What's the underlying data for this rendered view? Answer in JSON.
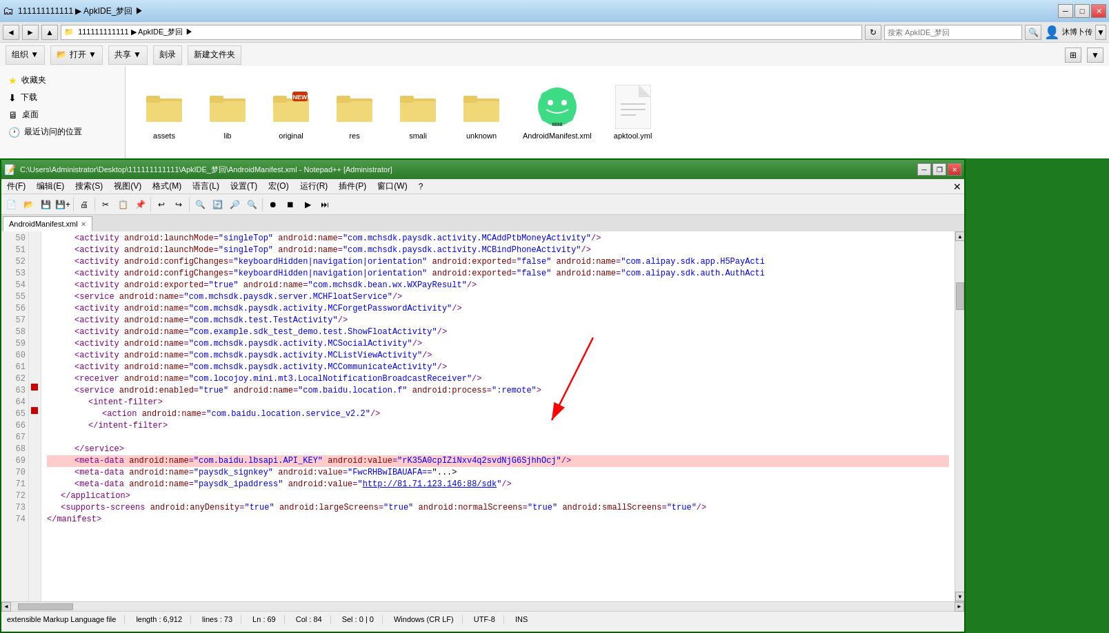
{
  "explorer": {
    "title": "111111111111",
    "path": "111111111111 ▶ ApkIDE_梦回 ▶",
    "search_placeholder": "搜索 ApkIDE_梦回",
    "nav_buttons": [
      "◄",
      "►",
      "▲"
    ],
    "toolbar_buttons": [
      "组织 ▼",
      "打开 ▼",
      "共享 ▼",
      "刻录",
      "新建文件夹"
    ],
    "sidebar_items": [
      {
        "label": "收藏夹",
        "icon": "star"
      },
      {
        "label": "下载",
        "icon": "folder"
      },
      {
        "label": "桌面",
        "icon": "desktop"
      },
      {
        "label": "最近访问的位置",
        "icon": "recent"
      }
    ],
    "files": [
      {
        "name": "assets",
        "type": "folder"
      },
      {
        "name": "lib",
        "type": "folder"
      },
      {
        "name": "original",
        "type": "folder-new"
      },
      {
        "name": "res",
        "type": "folder"
      },
      {
        "name": "smali",
        "type": "folder"
      },
      {
        "name": "unknown",
        "type": "folder"
      },
      {
        "name": "AndroidManifest.xml",
        "type": "android"
      },
      {
        "name": "apktool.yml",
        "type": "text"
      }
    ]
  },
  "notepad": {
    "title": "C:\\Users\\Administrator\\Desktop\\111111111111\\ApkIDE_梦回\\AndroidManifest.xml - Notepad++ [Administrator]",
    "tab_label": "AndroidManifest.xml",
    "menu_items": [
      "件(F)",
      "编辑(E)",
      "搜索(S)",
      "视图(V)",
      "格式(M)",
      "语言(L)",
      "设置(T)",
      "宏(O)",
      "运行(R)",
      "插件(P)",
      "窗口(W)",
      "?"
    ],
    "status": {
      "file_type": "extensible Markup Language file",
      "length": "length : 6,912",
      "lines": "lines : 73",
      "ln": "Ln : 69",
      "col": "Col : 84",
      "sel": "Sel : 0 | 0",
      "line_endings": "Windows (CR LF)",
      "encoding": "UTF-8",
      "mode": "INS"
    },
    "code_lines": [
      {
        "num": 50,
        "indent": 2,
        "content": "<activity android:launchMode=\"singleTop\" android:name=\"com.mchsdk.paysdk.activity.MCAddPtbMoneyActivity\"/>"
      },
      {
        "num": 51,
        "indent": 2,
        "content": "<activity android:launchMode=\"singleTop\" android:name=\"com.mchsdk.paysdk.activity.MCBindPhoneActivity\"/>"
      },
      {
        "num": 52,
        "indent": 2,
        "content": "<activity android:configChanges=\"keyboardHidden|navigation|orientation\" android:exported=\"false\" android:name=\"com.alipay.sdk.app.H5PayActi"
      },
      {
        "num": 53,
        "indent": 2,
        "content": "<activity android:configChanges=\"keyboardHidden|navigation|orientation\" android:exported=\"false\" android:name=\"com.alipay.sdk.auth.AuthActi"
      },
      {
        "num": 54,
        "indent": 2,
        "content": "<activity android:exported=\"true\" android:name=\"com.mchsdk.bean.wx.WXPayResult\"/>"
      },
      {
        "num": 55,
        "indent": 2,
        "content": "<service android:name=\"com.mchsdk.paysdk.server.MCHFloatService\"/>"
      },
      {
        "num": 56,
        "indent": 2,
        "content": "<activity android:name=\"com.mchsdk.paysdk.activity.MCForgetPasswordActivity\"/>"
      },
      {
        "num": 57,
        "indent": 2,
        "content": "<activity android:name=\"com.mchsdk.test.TestActivity\"/>"
      },
      {
        "num": 58,
        "indent": 2,
        "content": "<activity android:name=\"com.example.sdk_test_demo.test.ShowFloatActivity\"/>"
      },
      {
        "num": 59,
        "indent": 2,
        "content": "<activity android:name=\"com.mchsdk.paysdk.activity.MCSocialActivity\"/>"
      },
      {
        "num": 60,
        "indent": 2,
        "content": "<activity android:name=\"com.mchsdk.paysdk.activity.MCListViewActivity\"/>"
      },
      {
        "num": 61,
        "indent": 2,
        "content": "<activity android:name=\"com.mchsdk.paysdk.activity.MCCommunicateActivity\"/>"
      },
      {
        "num": 62,
        "indent": 2,
        "content": "<receiver android:name=\"com.locojoy.mini.mt3.LocalNotificationBroadcastReceiver\"/>"
      },
      {
        "num": 63,
        "indent": 2,
        "content": "<service android:enabled=\"true\" android:name=\"com.baidu.location.f\" android:process=\":remote\">"
      },
      {
        "num": 64,
        "indent": 3,
        "content": "<intent-filter>",
        "mark": true
      },
      {
        "num": 65,
        "indent": 4,
        "content": "<action android:name=\"com.baidu.location.service_v2.2\"/>"
      },
      {
        "num": 66,
        "indent": 3,
        "content": "</intent-filter>",
        "mark": true
      },
      {
        "num": 67,
        "indent": 0,
        "content": ""
      },
      {
        "num": 68,
        "indent": 2,
        "content": "</service>"
      },
      {
        "num": 69,
        "indent": 2,
        "content": "<meta-data android:name=\"com.baidu.lbsapi.API_KEY\" android:value=\"rK35A0cpIZiNxv4q2svdNjG6SjhhOcj\"/>",
        "highlight": true
      },
      {
        "num": 70,
        "indent": 2,
        "content": "<meta-data android:name=\"paysdk_signkey\" android:value=\"FwcRHBwIBAUAFA==\" .../>",
        "highlight": false
      },
      {
        "num": 71,
        "indent": 2,
        "content": "<meta-data android:name=\"paysdk_ipaddress\" android:value=\"http://81.71.123.146:88/sdk\"/>"
      },
      {
        "num": 72,
        "indent": 1,
        "content": "</application>"
      },
      {
        "num": 73,
        "indent": 1,
        "content": "<supports-screens android:anyDensity=\"true\" android:largeScreens=\"true\" android:normalScreens=\"true\" android:smallScreens=\"true\"/>"
      },
      {
        "num": 74,
        "indent": 0,
        "content": "</manifest>"
      }
    ]
  }
}
